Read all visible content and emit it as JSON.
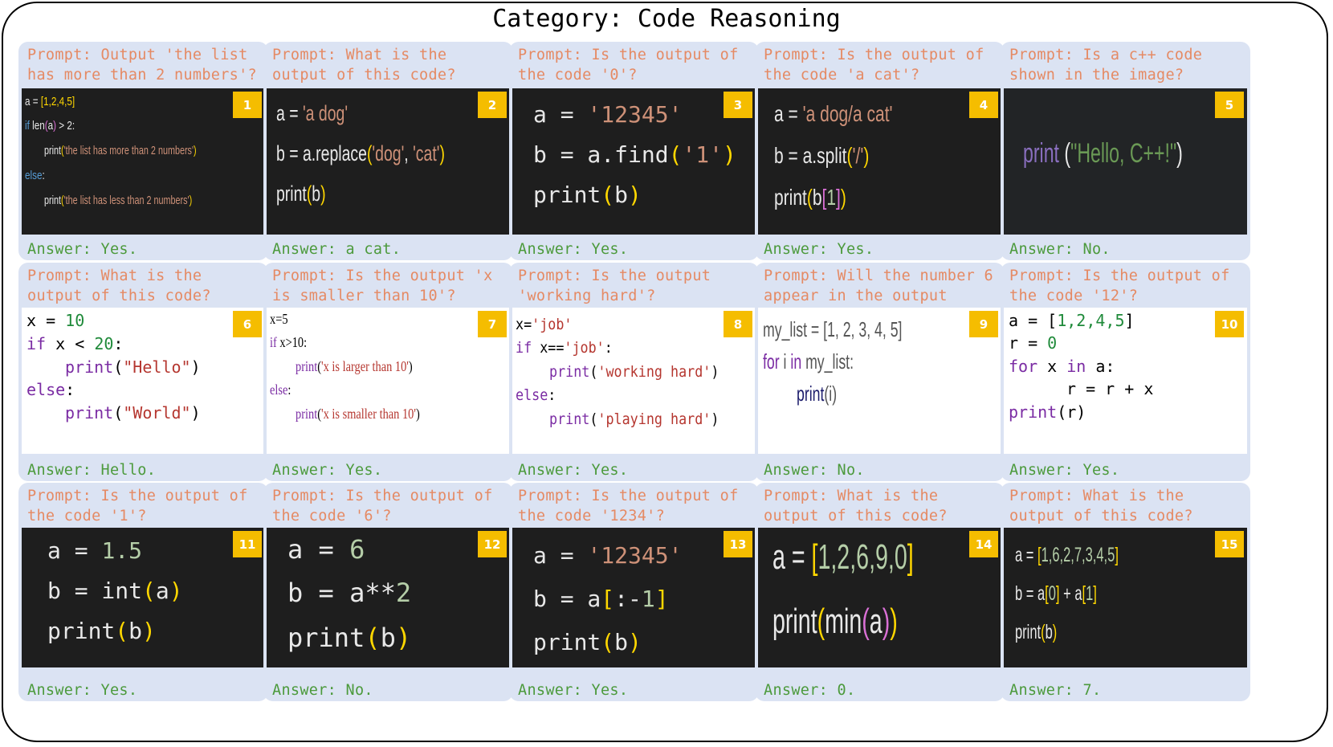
{
  "title": "Category: Code Reasoning",
  "cards": [
    {
      "num": "1",
      "prompt": "Prompt: Output 'the list has more than 2 numbers'?",
      "answer": "Answer: Yes.",
      "code": [
        "a = [1,2,4,5]",
        "if len(a) > 2:",
        "print('the list has more than 2 numbers')",
        "else:",
        "print('the list has less than 2 numbers')"
      ]
    },
    {
      "num": "2",
      "prompt": "Prompt: What is the output of this code?",
      "answer": "Answer: a cat.",
      "code": [
        "a = 'a dog'",
        "b = a.replace('dog', 'cat')",
        "print(b)"
      ]
    },
    {
      "num": "3",
      "prompt": "Prompt: Is the output of the code '0'?",
      "answer": "Answer: Yes.",
      "code": [
        "a = '12345'",
        "b = a.find('1')",
        "print(b)"
      ]
    },
    {
      "num": "4",
      "prompt": "Prompt: Is the output of the code 'a cat'?",
      "answer": "Answer: Yes.",
      "code": [
        "a = 'a dog/a cat'",
        "b = a.split('/')",
        "print(b[1])"
      ]
    },
    {
      "num": "5",
      "prompt": "Prompt: Is a c++ code shown in the image?",
      "answer": "Answer: No.",
      "code": [
        "print (\"Hello, C++!\")"
      ]
    },
    {
      "num": "6",
      "prompt": "Prompt: What is the output of this code?",
      "answer": "Answer: Hello.",
      "code": [
        "x = 10",
        "if x < 20:",
        "print(\"Hello\")",
        "else:",
        "print(\"World\")"
      ]
    },
    {
      "num": "7",
      "prompt": "Prompt: Is the output 'x is smaller than 10'?",
      "answer": "Answer: Yes.",
      "code": [
        "x=5",
        "if x>10:",
        "print('x is larger than 10')",
        "else:",
        "print('x is smaller than 10')"
      ]
    },
    {
      "num": "8",
      "prompt": "Prompt: Is the output 'working hard'?",
      "answer": "Answer: Yes.",
      "code": [
        "x='job'",
        "if x=='job':",
        "print('working hard')",
        "else:",
        "print('playing hard')"
      ]
    },
    {
      "num": "9",
      "prompt": "Prompt: Will the number 6 appear in the output",
      "answer": "Answer: No.",
      "code": [
        "my_list = [1, 2, 3, 4, 5]",
        "for i in my_list:",
        "print(i)"
      ]
    },
    {
      "num": "10",
      "prompt": "Prompt: Is the output of the code '12'?",
      "answer": "Answer: Yes.",
      "code": [
        "a = [1,2,4,5]",
        "r = 0",
        "for x in a:",
        "r = r + x",
        "print(r)"
      ]
    },
    {
      "num": "11",
      "prompt": "Prompt: Is the output of the code '1'?",
      "answer": "Answer: Yes.",
      "code": [
        "a = 1.5",
        "b = int(a)",
        "print(b)"
      ]
    },
    {
      "num": "12",
      "prompt": "Prompt: Is the output of the code '6'?",
      "answer": "Answer: No.",
      "code": [
        "a = 6",
        "b = a**2",
        "print(b)"
      ]
    },
    {
      "num": "13",
      "prompt": "Prompt: Is the output of the code '1234'?",
      "answer": "Answer: Yes.",
      "code": [
        "a = '12345'",
        "b = a[:-1]",
        "print(b)"
      ]
    },
    {
      "num": "14",
      "prompt": "Prompt: What is the output of this code?",
      "answer": "Answer: 0.",
      "code": [
        "a = [1,2,6,9,0]",
        "print(min(a))"
      ]
    },
    {
      "num": "15",
      "prompt": "Prompt: What is the output of this code?",
      "answer": "Answer: 7.",
      "code": [
        "a = [1,6,2,7,3,4,5]",
        "b = a[0] + a[1]",
        "print(b)"
      ]
    }
  ]
}
